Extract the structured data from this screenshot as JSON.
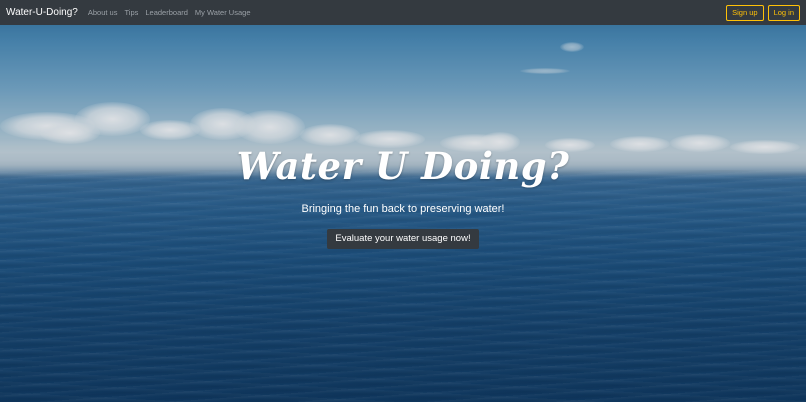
{
  "navbar": {
    "brand": "Water-U-Doing?",
    "links": [
      {
        "label": "About us"
      },
      {
        "label": "Tips"
      },
      {
        "label": "Leaderboard"
      },
      {
        "label": "My Water Usage"
      }
    ],
    "signup_label": "Sign up",
    "login_label": "Log in",
    "colors": {
      "background": "#343a40",
      "accent": "#ffc107"
    }
  },
  "hero": {
    "title": "Water U Doing?",
    "subtitle": "Bringing the fun back to preserving water!",
    "cta_label": "Evaluate your water usage now!",
    "background_image": "ocean-horizon-with-clouds"
  }
}
